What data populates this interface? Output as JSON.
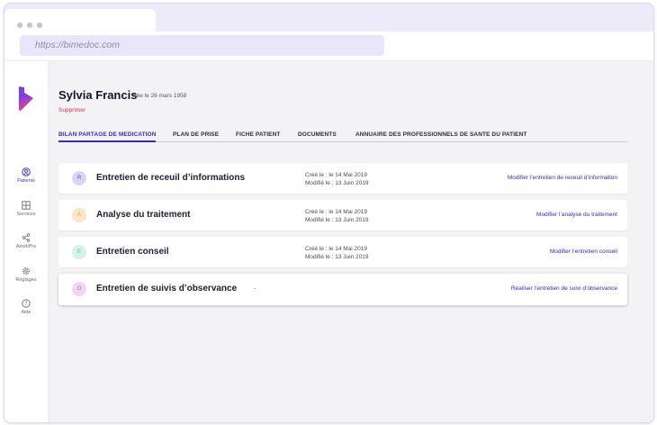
{
  "browser": {
    "url": "https://bimedoc.com"
  },
  "sidebar": {
    "items": [
      {
        "label": "Patients",
        "icon": "user-circle-icon",
        "active": true
      },
      {
        "label": "Services",
        "icon": "grid-icon",
        "active": false
      },
      {
        "label": "AmeliPro",
        "icon": "share-icon",
        "active": false
      },
      {
        "label": "Réglages",
        "icon": "gear-icon",
        "active": false
      },
      {
        "label": "Aide",
        "icon": "help-circle-icon",
        "active": false
      }
    ]
  },
  "patient": {
    "name": "Sylvia Francis",
    "dob": "née le 26 mars 1958",
    "delete_label": "Supprimer"
  },
  "tabs": [
    {
      "label": "BILAN PARTAGE DE MEDICATION",
      "active": true
    },
    {
      "label": "PLAN DE PRISE",
      "active": false
    },
    {
      "label": "FICHE PATIENT",
      "active": false
    },
    {
      "label": "DOCUMENTS",
      "active": false
    },
    {
      "label": "ANNUAIRE DES PROFESSIONNELS DE SANTE DU PATIENT",
      "active": false
    }
  ],
  "interviews": [
    {
      "badge": "R",
      "badge_bg": "#d8d5fa",
      "badge_fg": "#5b4fd1",
      "title": "Entretien de receuil d’informations",
      "created": "Créé le : le 14 Mai 2019",
      "modified": "Modifié le : 13 Juin 2019",
      "placeholder": "",
      "action": "Modifier l’entretien de receuil d’information"
    },
    {
      "badge": "A",
      "badge_bg": "#fde6c8",
      "badge_fg": "#e5a04a",
      "title": "Analyse du traitement",
      "created": "Créé le : le 14 Mai 2019",
      "modified": "Modifié le : 13 Juin 2019",
      "placeholder": "",
      "action": "Modifier l’analyse du traitement"
    },
    {
      "badge": "E",
      "badge_bg": "#d3f3ea",
      "badge_fg": "#5fc7a7",
      "title": "Entretien conseil",
      "created": "Créé le : le 14 Mai 2019",
      "modified": "Modifié le : 13 Juin 2019",
      "placeholder": "",
      "action": "Modifier l’entretien conseil"
    },
    {
      "badge": "O",
      "badge_bg": "#f4d3f6",
      "badge_fg": "#c35fd0",
      "title": "Entretien de suivis d’observance",
      "created": "",
      "modified": "",
      "placeholder": "-",
      "action": "Réaliser l’entretien de suivi d’observance"
    }
  ],
  "colors": {
    "accent": "#3b28c9",
    "danger": "#e0314a",
    "logo_top": "#7b3fe4",
    "logo_bottom": "#ff3d8b"
  }
}
